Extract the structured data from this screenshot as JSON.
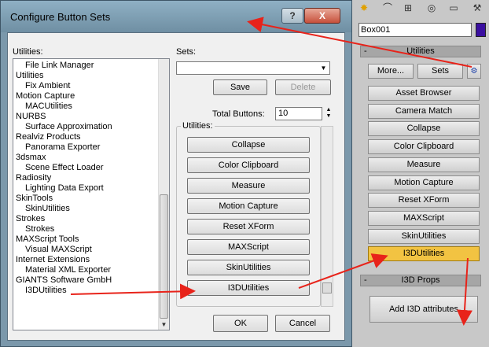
{
  "dialog": {
    "title": "Configure Button Sets",
    "help_glyph": "?",
    "close_glyph": "X",
    "utilities_label": "Utilities:",
    "sets_label": "Sets:",
    "sets_value": "",
    "save_label": "Save",
    "delete_label": "Delete",
    "total_buttons_label": "Total Buttons:",
    "total_buttons_value": "10",
    "group_label": "Utilities:",
    "ok_label": "OK",
    "cancel_label": "Cancel",
    "list_items": [
      {
        "text": "File Link Manager",
        "indent": true
      },
      {
        "text": "Utilities",
        "indent": false
      },
      {
        "text": "Fix Ambient",
        "indent": true
      },
      {
        "text": "Motion Capture",
        "indent": false
      },
      {
        "text": "MACUtilities",
        "indent": true
      },
      {
        "text": "NURBS",
        "indent": false
      },
      {
        "text": "Surface Approximation",
        "indent": true
      },
      {
        "text": "Realviz Products",
        "indent": false
      },
      {
        "text": "Panorama Exporter",
        "indent": true
      },
      {
        "text": "3dsmax",
        "indent": false
      },
      {
        "text": "Scene Effect Loader",
        "indent": true
      },
      {
        "text": "Radiosity",
        "indent": false
      },
      {
        "text": "Lighting Data Export",
        "indent": true
      },
      {
        "text": "SkinTools",
        "indent": false
      },
      {
        "text": "SkinUtilities",
        "indent": true
      },
      {
        "text": "Strokes",
        "indent": false
      },
      {
        "text": "Strokes",
        "indent": true
      },
      {
        "text": "MAXScript Tools",
        "indent": false
      },
      {
        "text": "Visual MAXScript",
        "indent": true
      },
      {
        "text": "Internet Extensions",
        "indent": false
      },
      {
        "text": "Material XML Exporter",
        "indent": true
      },
      {
        "text": "GIANTS Software GmbH",
        "indent": false
      },
      {
        "text": "I3DUtilities",
        "indent": true
      }
    ],
    "set_buttons": [
      "Collapse",
      "Color Clipboard",
      "Measure",
      "Motion Capture",
      "Reset XForm",
      "MAXScript",
      "SkinUtilities",
      "I3DUtilities"
    ]
  },
  "panel": {
    "object_name": "Box001",
    "object_color": "#3a0fa0",
    "utilities_rollout": "Utilities",
    "more_label": "More...",
    "sets_label": "Sets",
    "utility_buttons": [
      "Asset Browser",
      "Camera Match",
      "Collapse",
      "Color Clipboard",
      "Measure",
      "Motion Capture",
      "Reset XForm",
      "MAXScript",
      "SkinUtilities",
      "I3DUtilities"
    ],
    "active_utility": "I3DUtilities",
    "i3d_rollout": "I3D Props",
    "add_attributes_label": "Add I3D attributes",
    "rollout_minus": "-"
  },
  "colors": {
    "active_button": "#f2c342",
    "annotation_arrow": "#e8231a"
  }
}
